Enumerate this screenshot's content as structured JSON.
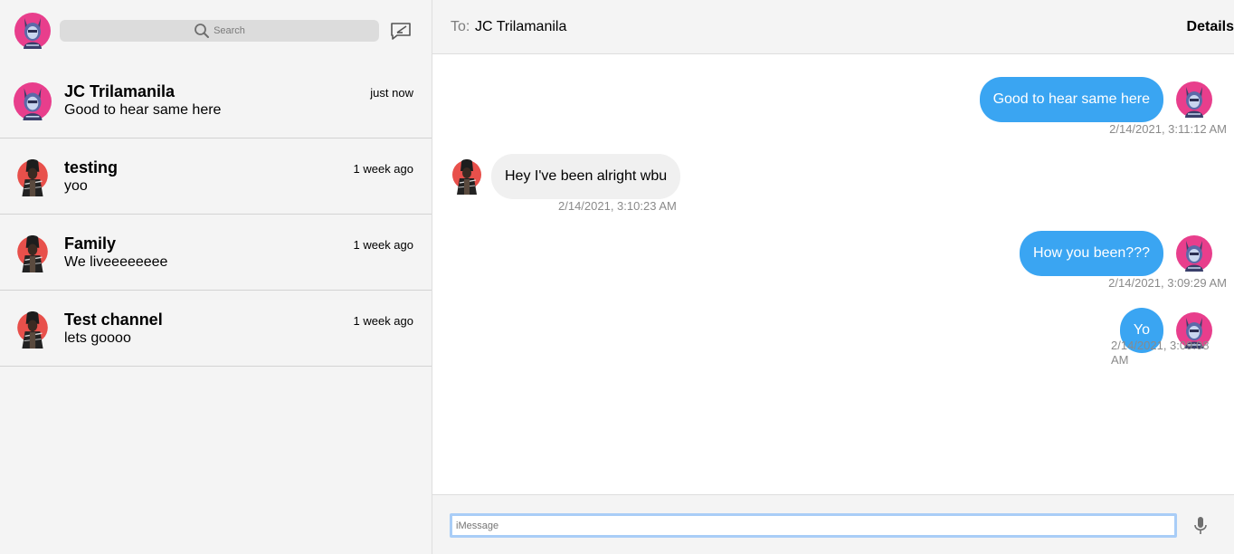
{
  "sidebar": {
    "search_placeholder": "Search",
    "conversations": [
      {
        "name": "JC Trilamanila",
        "preview": "Good to hear same here",
        "time": "just now",
        "avatar": "anime-avatar"
      },
      {
        "name": "testing",
        "preview": "yoo",
        "time": "1 week ago",
        "avatar": "warrior-avatar"
      },
      {
        "name": "Family",
        "preview": "We liveeeeeeee",
        "time": "1 week ago",
        "avatar": "warrior-avatar"
      },
      {
        "name": "Test channel",
        "preview": "lets goooo",
        "time": "1 week ago",
        "avatar": "warrior-avatar"
      }
    ]
  },
  "chat": {
    "to_label": "To:",
    "to_name": "JC Trilamanila",
    "details_label": "Details",
    "messages": [
      {
        "text": "Good to hear same here",
        "timestamp": "2/14/2021, 3:11:12 AM",
        "direction": "outgoing"
      },
      {
        "text": "Hey I've been alright wbu",
        "timestamp": "2/14/2021, 3:10:23 AM",
        "direction": "incoming"
      },
      {
        "text": "How you been???",
        "timestamp": "2/14/2021, 3:09:29 AM",
        "direction": "outgoing"
      },
      {
        "text": "Yo",
        "timestamp": "2/14/2021, 3:09:08 AM",
        "direction": "outgoing"
      }
    ],
    "input_placeholder": "iMessage"
  },
  "colors": {
    "outgoing_bubble": "#3aa5f2",
    "incoming_bubble": "#f0f0f0",
    "anime_avatar_bg": "#e83e8c",
    "warrior_avatar_bg": "#e8504b"
  },
  "icons": {
    "search": "search-icon",
    "compose": "compose-icon",
    "mic": "microphone-icon"
  }
}
